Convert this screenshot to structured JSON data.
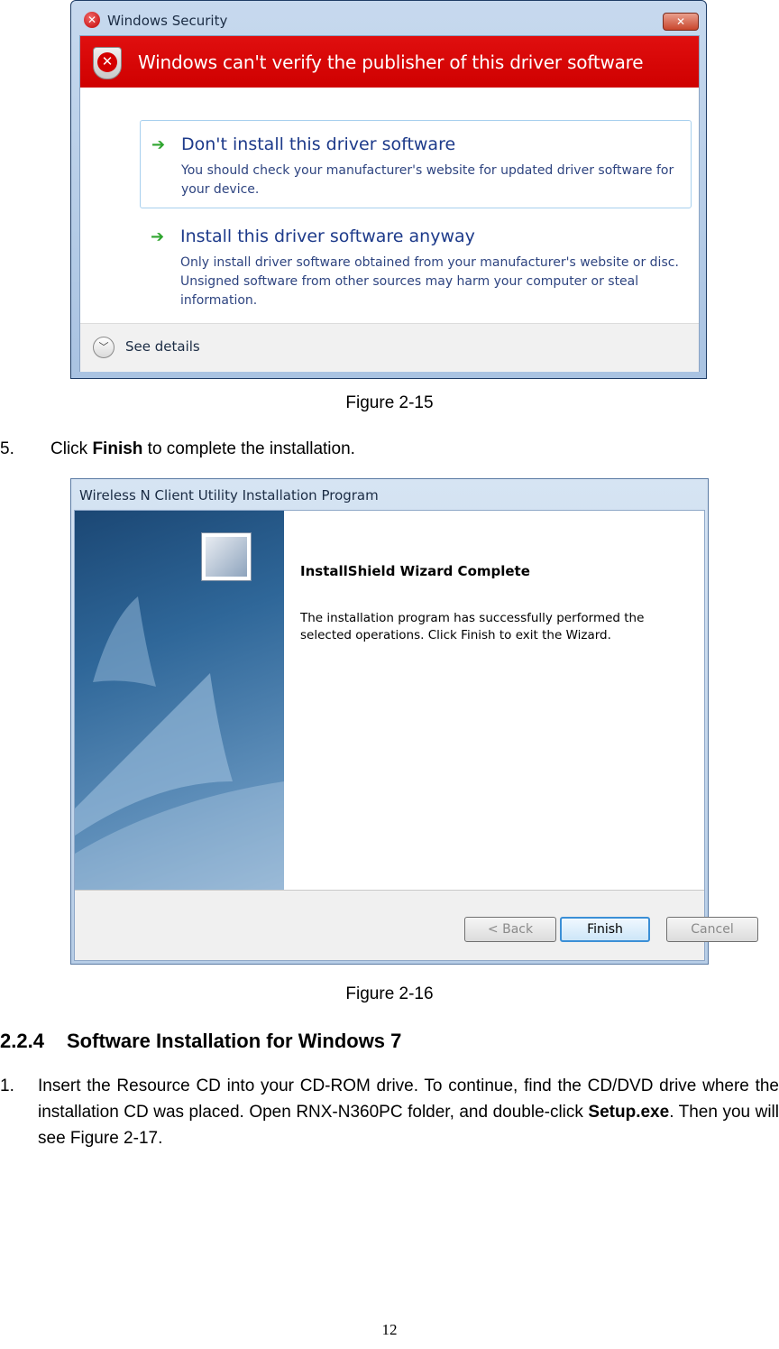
{
  "figure_15": {
    "window_title": "Windows Security",
    "close_glyph": "✕",
    "banner_text": "Windows can't verify the publisher of this driver software",
    "options": [
      {
        "title": "Don't install this driver software",
        "description": "You should check your manufacturer's website for updated driver software for your device."
      },
      {
        "title": "Install this driver software anyway",
        "description": "Only install driver software obtained from your manufacturer's website or disc. Unsigned software from other sources may harm your computer or steal information."
      }
    ],
    "see_details": "See details",
    "caption": "Figure 2-15"
  },
  "step5": {
    "number": "5.",
    "prefix": "Click ",
    "bold": "Finish",
    "suffix": " to complete the installation."
  },
  "figure_16": {
    "window_title": "Wireless N Client Utility Installation Program",
    "heading": "InstallShield Wizard Complete",
    "description": "The installation program has successfully performed the selected operations.  Click Finish to exit the Wizard.",
    "buttons": {
      "back": "< Back",
      "finish": "Finish",
      "cancel": "Cancel"
    },
    "caption": "Figure 2-16"
  },
  "section": {
    "number": "2.2.4",
    "title": "Software Installation for Windows 7"
  },
  "step1": {
    "number": "1.",
    "text_1": "Insert the Resource CD into your CD-ROM drive. To continue, find the CD/DVD drive where the installation CD was placed. Open RNX-N360PC folder, and double-click ",
    "bold": "Setup.exe",
    "text_2": ". Then you will see Figure 2-17."
  },
  "page_number": "12",
  "colors": {
    "banner_red": "#d40000",
    "option_title_blue": "#1d3a8a",
    "arrow_green": "#2fa52f"
  },
  "icons": [
    "windows-security-icon",
    "shield-error-icon",
    "green-arrow-icon",
    "chevron-down-icon",
    "installshield-logo-icon"
  ]
}
